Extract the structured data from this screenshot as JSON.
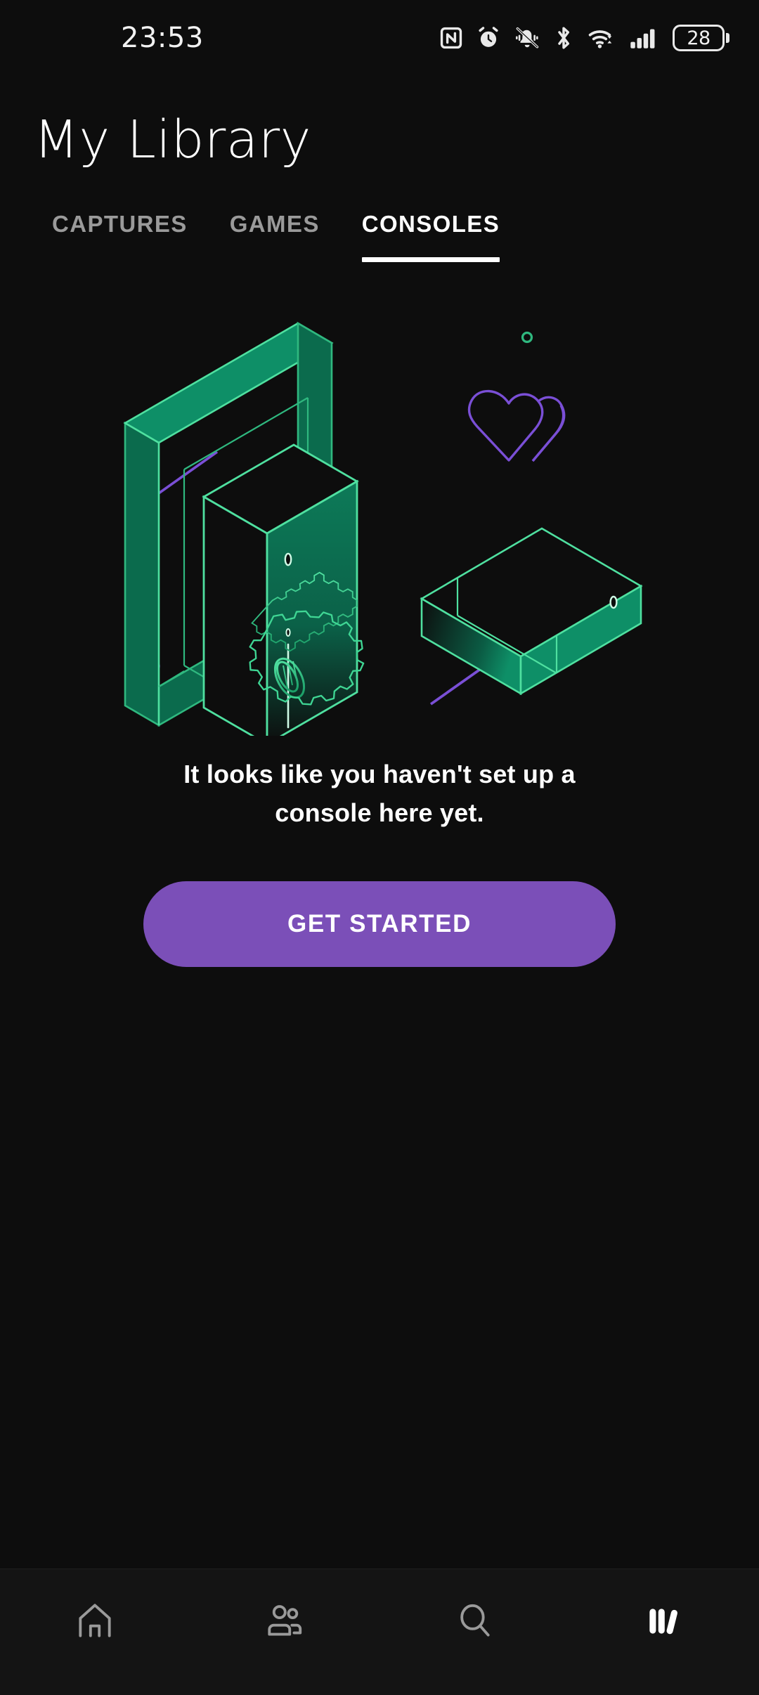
{
  "status_bar": {
    "clock": "23:53",
    "battery_level": "28",
    "icons": [
      {
        "name": "nfc-icon"
      },
      {
        "name": "alarm-clock-icon"
      },
      {
        "name": "bell-muted-icon"
      },
      {
        "name": "bluetooth-icon"
      },
      {
        "name": "wifi-icon"
      },
      {
        "name": "cellular-signal-icon"
      },
      {
        "name": "battery-icon"
      }
    ]
  },
  "header": {
    "title": "My Library"
  },
  "tabs": [
    {
      "label": "CAPTURES",
      "active": false
    },
    {
      "label": "GAMES",
      "active": false
    },
    {
      "label": "CONSOLES",
      "active": true
    }
  ],
  "illustration": {
    "name": "consoles-empty-state-illustration",
    "colors": {
      "green_fill_dark": "#0b6b4d",
      "green_fill_mid": "#0e8f67",
      "green_stroke": "#4fe0a0",
      "purple_accent": "#7a4fd6",
      "background": "#0d0d0d"
    },
    "elements": [
      "tv-frame",
      "tower-console",
      "flat-console",
      "heart-outline",
      "gear-outline",
      "accent-dot-green-small",
      "accent-dot-green-ring",
      "accent-dot-purple-ring",
      "accent-line-purple-left",
      "accent-line-purple-right"
    ]
  },
  "empty_state": {
    "message": "It looks like you haven't set up a console here yet.",
    "cta_label": "GET STARTED",
    "cta_color": "#7b4fb8"
  },
  "bottom_nav": {
    "items": [
      {
        "name": "home",
        "icon": "home-icon",
        "active": false
      },
      {
        "name": "social",
        "icon": "people-icon",
        "active": false
      },
      {
        "name": "search",
        "icon": "search-icon",
        "active": false
      },
      {
        "name": "library",
        "icon": "library-books-icon",
        "active": true
      }
    ]
  }
}
